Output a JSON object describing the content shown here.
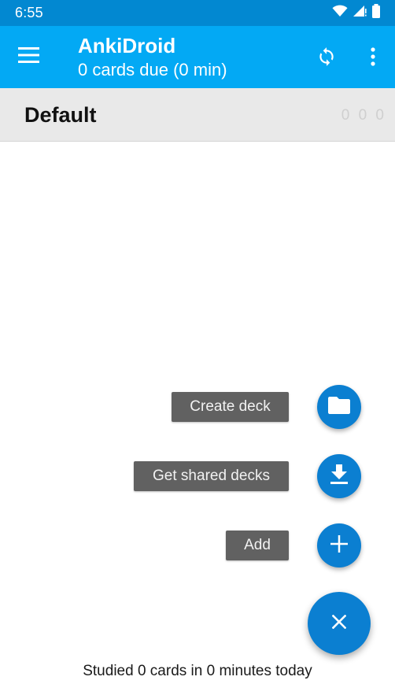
{
  "status_bar": {
    "time": "6:55",
    "icons": [
      "wifi-icon",
      "signal-icon",
      "battery-icon"
    ]
  },
  "toolbar": {
    "title": "AnkiDroid",
    "subtitle": "0 cards due (0 min)",
    "color": "#03a9f4",
    "icons": [
      "menu-icon",
      "sync-icon",
      "more-vert-icon"
    ]
  },
  "deck_list": {
    "items": [
      {
        "name": "Default",
        "counts": "0 0 0"
      }
    ]
  },
  "fab_menu": {
    "items": [
      {
        "label": "Create deck",
        "icon": "folder-icon"
      },
      {
        "label": "Get shared decks",
        "icon": "download-icon"
      },
      {
        "label": "Add",
        "icon": "plus-icon"
      }
    ],
    "close_icon": "close-icon",
    "accent": "#0b7fd1"
  },
  "footer": {
    "studied_text": "Studied 0 cards in 0 minutes today"
  }
}
